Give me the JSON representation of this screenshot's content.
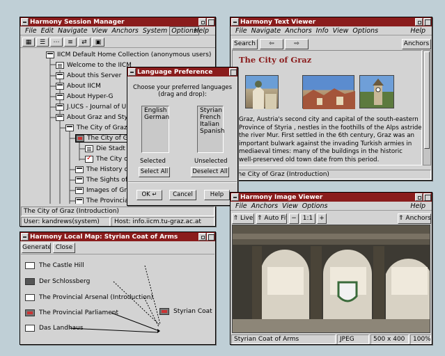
{
  "session_manager": {
    "title": "Harmony Session Manager",
    "menus": [
      "File",
      "Edit",
      "Navigate",
      "View",
      "Anchors",
      "System",
      "Options"
    ],
    "help": "Help",
    "toolbar_icons": [
      "collection-icon",
      "tree-icon",
      "dots-icon",
      "list-icon",
      "link-icon",
      "image-icon"
    ],
    "tree": [
      {
        "label": "IICM Default Home Collection (anonymous users)",
        "icon": "coll"
      },
      {
        "label": "Welcome to the IICM",
        "icon": "doc"
      },
      {
        "label": "About this Server",
        "icon": "coll"
      },
      {
        "label": "About IICM",
        "icon": "coll"
      },
      {
        "label": "About Hyper-G",
        "icon": "coll"
      },
      {
        "label": "J.UCS - Journal of U",
        "icon": "coll"
      },
      {
        "label": "About Graz and Styri",
        "icon": "coll"
      },
      {
        "label": "The City of Graz",
        "icon": "coll"
      },
      {
        "label": "The City of Graz",
        "icon": "img"
      },
      {
        "label": "Die Stadt Gra",
        "icon": "doc"
      },
      {
        "label": "The City of G",
        "icon": "chk"
      },
      {
        "label": "The History of G",
        "icon": "coll"
      },
      {
        "label": "The Sights of Gr",
        "icon": "coll"
      },
      {
        "label": "Images of Graz",
        "icon": "coll"
      },
      {
        "label": "The Provincial A",
        "icon": "coll"
      }
    ],
    "status": "The City of Graz (Introduction)",
    "user": "User: kandrews(system)",
    "host": "Host: info.iicm.tu-graz.ac.at"
  },
  "language_dialog": {
    "title": "Language Preference",
    "instructions_line1": "Choose your preferred languages",
    "instructions_line2": "(drag and drop):",
    "selected": [
      "English",
      "German"
    ],
    "unselected": [
      "Styrian",
      "French",
      "Italian",
      "Spanish"
    ],
    "selected_label": "Selected",
    "unselected_label": "Unselected",
    "select_all": "Select All",
    "deselect_all": "Deselect All",
    "ok": "OK",
    "cancel": "Cancel",
    "help": "Help"
  },
  "text_viewer": {
    "title": "Harmony Text Viewer",
    "menus": [
      "File",
      "Navigate",
      "Anchors",
      "Info",
      "View",
      "Options"
    ],
    "help": "Help",
    "search": "Search",
    "anchors": "Anchors",
    "heading": "The City of Graz",
    "body_lines": [
      "Graz, Austria's second city and capital of the south-eastern",
      "Province of Styria , nestles in the foothills of the Alps astride",
      "the river Mur. First settled in the 6th century, Graz was an",
      "important bulwark against the invading Turkish armies in",
      "mediaeval times: many of the buildings in the historic",
      "well-preserved old town date from this period."
    ],
    "status": "The City of Graz (Introduction)"
  },
  "local_map": {
    "title": "Harmony Local Map: Styrian Coat of Arms",
    "generate": "Generate",
    "close": "Close",
    "items": [
      {
        "label": "The Castle Hill",
        "icon": "plain"
      },
      {
        "label": "Der Schlossberg",
        "icon": "dark"
      },
      {
        "label": "The Provincial Arsenal (Introduction)",
        "icon": "plain"
      },
      {
        "label": "The Provincial Parliament",
        "icon": "pic"
      },
      {
        "label": "Das Landhaus",
        "icon": "plain"
      }
    ],
    "target": "Styrian Coat"
  },
  "image_viewer": {
    "title": "Harmony Image Viewer",
    "menus": [
      "File",
      "Anchors",
      "View",
      "Options"
    ],
    "help": "Help",
    "live": "Live",
    "auto_fit": "Auto Fit",
    "zoom": "1:1",
    "anchors": "Anchors",
    "status_name": "Styrian Coat of Arms",
    "status_format": "JPEG",
    "status_size": "500 x 400",
    "status_zoom": "100%"
  }
}
